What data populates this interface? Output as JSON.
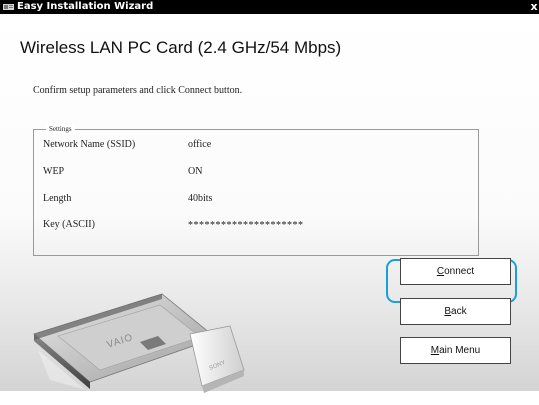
{
  "window": {
    "title": "Easy Installation Wizard",
    "close_glyph": "x"
  },
  "main": {
    "heading": "Wireless LAN PC Card (2.4 GHz/54 Mbps)",
    "instruction": "Confirm setup parameters and click Connect button."
  },
  "settings": {
    "legend": "Settings",
    "rows": [
      {
        "label": "Network Name (SSID)",
        "value": "office"
      },
      {
        "label": "WEP",
        "value": "ON"
      },
      {
        "label": "Length",
        "value": "40bits"
      },
      {
        "label": "Key (ASCII)",
        "value": "*********************"
      }
    ]
  },
  "buttons": {
    "connect": {
      "mnemonic": "C",
      "rest": "onnect"
    },
    "back": {
      "mnemonic": "B",
      "rest": "ack"
    },
    "main_menu": {
      "mnemonic": "M",
      "rest": "ain Menu"
    }
  },
  "illustration": {
    "brand_logo": "VAIO",
    "maker_logo": "SONY"
  },
  "colors": {
    "focus_ring": "#1aa0d8",
    "titlebar": "#000000"
  },
  "icons": [
    "wizard-app-icon",
    "close-icon"
  ]
}
